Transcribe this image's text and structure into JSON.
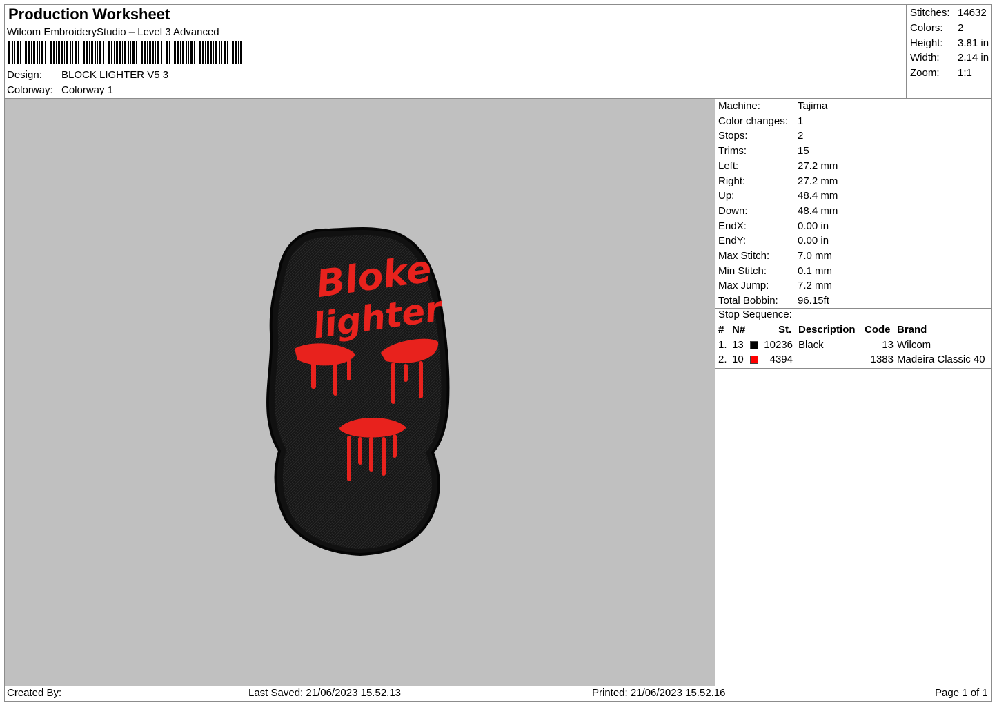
{
  "header": {
    "title": "Production Worksheet",
    "software": "Wilcom EmbroideryStudio – Level 3 Advanced",
    "design_label": "Design:",
    "design_value": "BLOCK LIGHTER V5 3",
    "colorway_label": "Colorway:",
    "colorway_value": "Colorway 1"
  },
  "summary": [
    {
      "label": "Stitches:",
      "value": "14632"
    },
    {
      "label": "Colors:",
      "value": "2"
    },
    {
      "label": "Height:",
      "value": "3.81 in"
    },
    {
      "label": "Width:",
      "value": "2.14 in"
    },
    {
      "label": "Zoom:",
      "value": "1:1"
    }
  ],
  "details": [
    {
      "label": "Machine:",
      "value": "Tajima"
    },
    {
      "label": "Color changes:",
      "value": "1"
    },
    {
      "label": "Stops:",
      "value": "2"
    },
    {
      "label": "Trims:",
      "value": "15"
    },
    {
      "label": "Left:",
      "value": "27.2 mm"
    },
    {
      "label": "Right:",
      "value": "27.2 mm"
    },
    {
      "label": "Up:",
      "value": "48.4 mm"
    },
    {
      "label": "Down:",
      "value": "48.4 mm"
    },
    {
      "label": "EndX:",
      "value": "0.00 in"
    },
    {
      "label": "EndY:",
      "value": "0.00 in"
    },
    {
      "label": "Max Stitch:",
      "value": "7.0 mm"
    },
    {
      "label": "Min Stitch:",
      "value": "0.1 mm"
    },
    {
      "label": "Max Jump:",
      "value": "7.2 mm"
    },
    {
      "label": "Total Bobbin:",
      "value": "96.15ft"
    }
  ],
  "stop_sequence": {
    "title": "Stop Sequence:",
    "columns": [
      "#",
      "N#",
      "St.",
      "Description",
      "Code",
      "Brand"
    ],
    "rows": [
      {
        "num": "1.",
        "n": "13",
        "color": "#000000",
        "st": "10236",
        "description": "Black",
        "code": "13",
        "brand": "Wilcom"
      },
      {
        "num": "2.",
        "n": "10",
        "color": "#ff0000",
        "st": "4394",
        "description": "",
        "code": "1383",
        "brand": "Madeira Classic 40"
      }
    ]
  },
  "design_art": {
    "text_line1": "Bloke",
    "text_line2": "lighter",
    "patch_color": "#161616",
    "thread_color": "#e8221d",
    "canvas_color": "#c0c0c0"
  },
  "footer": {
    "created_by": "Created By:",
    "last_saved": "Last Saved: 21/06/2023 15.52.13",
    "printed": "Printed: 21/06/2023 15.52.16",
    "page": "Page 1 of 1"
  }
}
